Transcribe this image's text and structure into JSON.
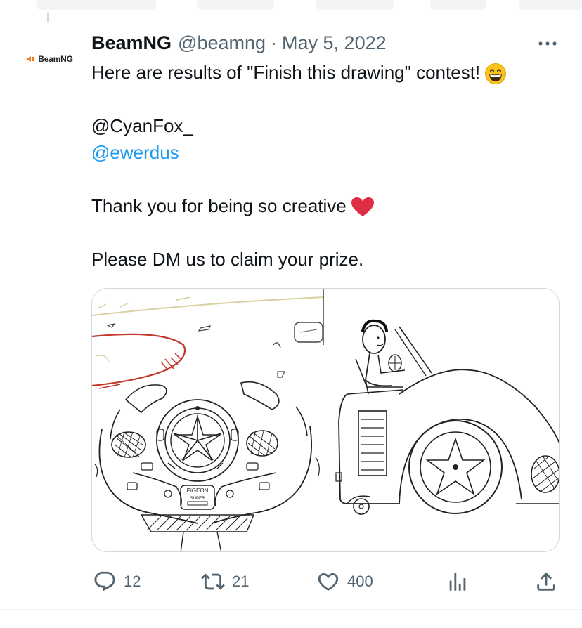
{
  "tweet": {
    "author_name": "BeamNG",
    "author_handle": "@beamng",
    "separator": "·",
    "date": "May 5, 2022",
    "avatar_text": "BeamNG",
    "lines": {
      "line1": "Here are results of \"Finish this drawing\" contest!",
      "mention1": "@CyanFox_",
      "mention2": "@ewerdus",
      "thanks": "Thank you for being so creative",
      "dm": "Please DM us to claim your prize."
    },
    "emojis": [
      "grinning-face-with-smiling-eyes",
      "red-heart"
    ],
    "image_text": {
      "wheel_badge_top": "PiGEON",
      "wheel_badge_mid": "SUPER"
    }
  },
  "metrics": {
    "replies": "12",
    "retweets": "21",
    "likes": "400"
  },
  "colors": {
    "text_primary": "#0f1419",
    "text_secondary": "#536471",
    "link": "#1d9bf0",
    "border": "#cfd9de",
    "heart": "#e0245e",
    "brand_orange": "#f07a20"
  }
}
